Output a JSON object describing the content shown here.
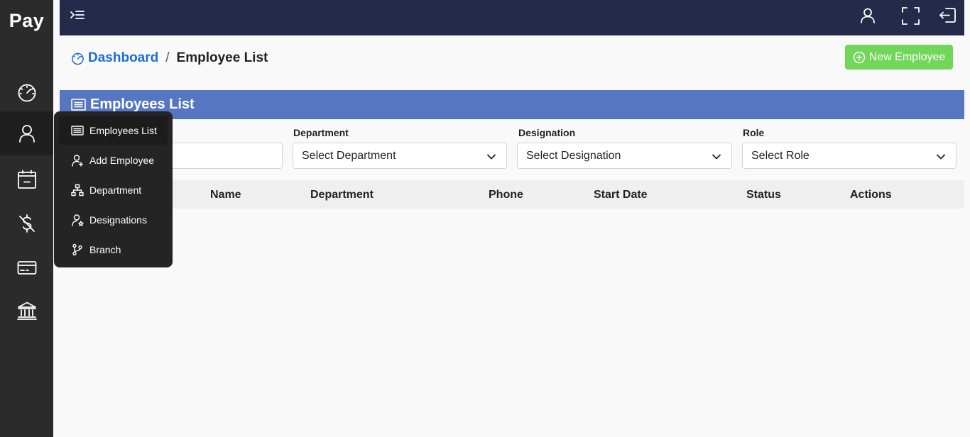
{
  "app": {
    "brand": "Pay"
  },
  "sidebar": {
    "icons": [
      "speedometer-icon",
      "user-icon",
      "calendar-icon",
      "dollar-off-icon",
      "credit-card-icon",
      "bank-icon"
    ]
  },
  "flyout": {
    "items": [
      {
        "label": "Employees List",
        "icon": "list-icon"
      },
      {
        "label": "Add Employee",
        "icon": "user-add-icon"
      },
      {
        "label": "Department",
        "icon": "hierarchy-icon"
      },
      {
        "label": "Designations",
        "icon": "user-star-icon"
      },
      {
        "label": "Branch",
        "icon": "git-branch-icon"
      }
    ]
  },
  "breadcrumb": {
    "parent": "Dashboard",
    "separator": "/",
    "current": "Employee List"
  },
  "actions": {
    "new_employee": "New Employee"
  },
  "card": {
    "title": "Employees List"
  },
  "filters": {
    "department": {
      "label": "Department",
      "value": "Select Department"
    },
    "designation": {
      "label": "Designation",
      "value": "Select Designation"
    },
    "role": {
      "label": "Role",
      "value": "Select Role"
    }
  },
  "table": {
    "columns": [
      "Name",
      "Department",
      "Phone",
      "Start Date",
      "Status",
      "Actions"
    ]
  },
  "colors": {
    "sidebar": "#2b2b2b",
    "topbar": "#232a4a",
    "card_header": "#5577c2",
    "accent_link": "#1a6fd6",
    "button_green": "#72d65a"
  }
}
